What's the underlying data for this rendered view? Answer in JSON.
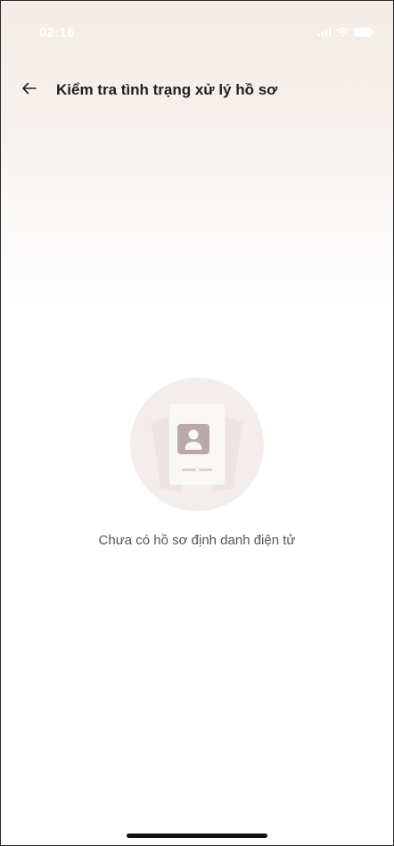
{
  "status_bar": {
    "time": "02:16"
  },
  "header": {
    "title": "Kiểm tra tình trạng xử lý hồ sơ"
  },
  "empty_state": {
    "message": "Chưa có hồ sơ định danh điện tử"
  },
  "icons": {
    "back": "arrow-left-icon",
    "illustration": "id-card-illustration-icon",
    "signal": "signal-icon",
    "wifi": "wifi-icon",
    "battery": "battery-icon"
  },
  "colors": {
    "header_gradient_top": "#f3ece7",
    "illustration_bg": "#f3eeec",
    "illustration_card_icon": "#b9a9ad",
    "title_text": "#1f1f1f",
    "message_text": "#555555"
  }
}
